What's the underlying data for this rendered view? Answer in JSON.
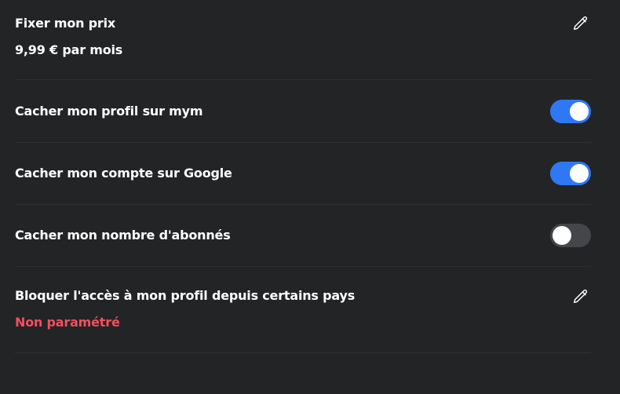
{
  "price": {
    "title": "Fixer mon prix",
    "value": "9,99 € par mois",
    "edit_icon": "pencil-icon"
  },
  "settings": [
    {
      "label": "Cacher mon profil sur mym",
      "enabled": true
    },
    {
      "label": "Cacher mon compte sur Google",
      "enabled": true
    },
    {
      "label": "Cacher mon nombre d'abonnés",
      "enabled": false
    }
  ],
  "geo_block": {
    "title": "Bloquer l'accès à mon profil depuis certains pays",
    "value": "Non paramétré",
    "value_color": "#f0505e",
    "edit_icon": "pencil-icon"
  },
  "colors": {
    "background": "#232426",
    "toggle_on": "#2f78f5",
    "toggle_off": "#45464a",
    "warning": "#f0505e"
  }
}
